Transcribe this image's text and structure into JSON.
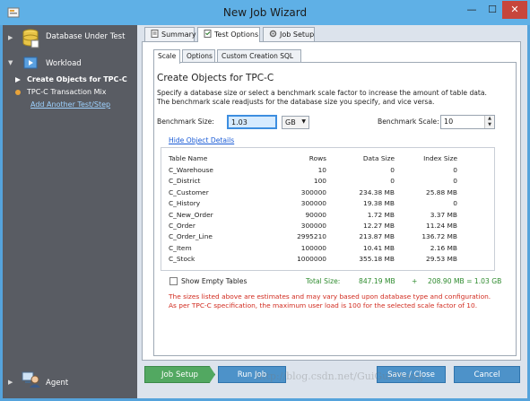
{
  "window": {
    "title": "New Job Wizard",
    "minimize": "—",
    "maximize": "☐",
    "close": "✕"
  },
  "sidebar": {
    "database_label": "Database Under Test",
    "workload_label": "Workload",
    "items": [
      {
        "label": "Create Objects for TPC-C",
        "selected": true
      },
      {
        "label": "TPC-C Transaction Mix",
        "selected": false
      }
    ],
    "add_link": "Add Another Test/Step",
    "agent_label": "Agent",
    "expander": "▶",
    "expander_open": "▼"
  },
  "tabs": [
    {
      "label": "Summary",
      "icon": "summary-icon"
    },
    {
      "label": "Test Options",
      "icon": "test-options-icon",
      "active": true
    },
    {
      "label": "Job Setup",
      "icon": "job-setup-icon"
    }
  ],
  "subtabs": [
    {
      "label": "Scale",
      "active": true
    },
    {
      "label": "Options"
    },
    {
      "label": "Custom Creation SQL"
    }
  ],
  "scale": {
    "title": "Create Objects for TPC-C",
    "description": "Specify a database size or select a benchmark scale factor to increase the amount of table data. The benchmark scale readjusts for the database size you specify, and vice versa.",
    "benchmark_size_label": "Benchmark Size:",
    "benchmark_size_value": "1.03",
    "unit_value": "GB",
    "benchmark_scale_label": "Benchmark Scale:",
    "benchmark_scale_value": "10",
    "hide_details_link": "Hide Object Details"
  },
  "object_table": {
    "headers": [
      "Table Name",
      "Rows",
      "Data Size",
      "Index Size"
    ],
    "rows": [
      [
        "C_Warehouse",
        "10",
        "0",
        "0"
      ],
      [
        "C_District",
        "100",
        "0",
        "0"
      ],
      [
        "C_Customer",
        "300000",
        "234.38 MB",
        "25.88 MB"
      ],
      [
        "C_History",
        "300000",
        "19.38 MB",
        "0"
      ],
      [
        "C_New_Order",
        "90000",
        "1.72 MB",
        "3.37 MB"
      ],
      [
        "C_Order",
        "300000",
        "12.27 MB",
        "11.24 MB"
      ],
      [
        "C_Order_Line",
        "2995210",
        "213.87 MB",
        "136.72 MB"
      ],
      [
        "C_Item",
        "100000",
        "10.41 MB",
        "2.16 MB"
      ],
      [
        "C_Stock",
        "1000000",
        "355.18 MB",
        "29.53 MB"
      ]
    ]
  },
  "totals": {
    "show_empty_label": "Show Empty Tables",
    "total_label": "Total Size:",
    "data_total": "847.19 MB",
    "plus": "+",
    "summary": "208.90 MB = 1.03 GB"
  },
  "notes": [
    "The sizes listed above are estimates and may vary based upon database type and configuration.",
    "As per TPC-C specification, the maximum user load is 100 for the selected scale factor of 10."
  ],
  "buttons": {
    "job_setup": "Job Setup",
    "run_job": "Run Job",
    "save_close": "Save / Close",
    "cancel": "Cancel"
  },
  "watermark": "http://blog.csdn.net/GuiGuiZhang",
  "colors": {
    "sidebar_bg": "#595c63",
    "main_bg": "#dce3ec",
    "titlebar": "#5fb0e6",
    "link": "#1a5bd6",
    "note": "#d12b1f",
    "total": "#2e8b2e",
    "button_green": "#52a861",
    "button_blue": "#4d92c9"
  }
}
